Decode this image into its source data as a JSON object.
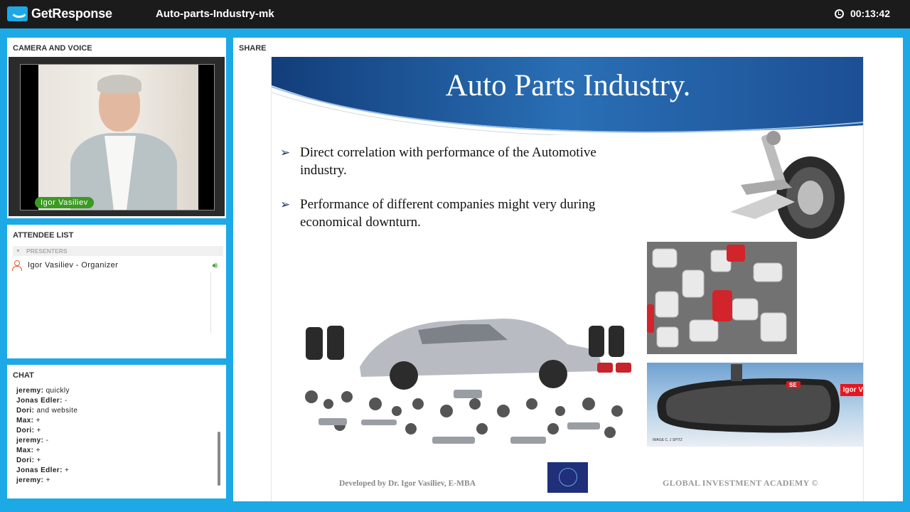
{
  "header": {
    "brand": "GetResponse",
    "webinar_title": "Auto-parts-Industry-mk",
    "timer": "00:13:42"
  },
  "camera": {
    "title": "CAMERA AND VOICE",
    "presenter_name": "Igor Vasiliev"
  },
  "attendees": {
    "title": "ATTENDEE LIST",
    "group_label": "PRESENTERS",
    "items": [
      {
        "name": "Igor Vasiliev - Organizer",
        "audio": "speaker-on-icon"
      }
    ]
  },
  "chat": {
    "title": "CHAT",
    "messages": [
      {
        "author": "jeremy:",
        "text": "quickly"
      },
      {
        "author": "Jonas Edler:",
        "text": "-"
      },
      {
        "author": "Dori:",
        "text": "and website"
      },
      {
        "author": "Max:",
        "text": "+"
      },
      {
        "author": "Dori:",
        "text": "+"
      },
      {
        "author": "jeremy:",
        "text": "-"
      },
      {
        "author": "Max:",
        "text": "+"
      },
      {
        "author": "Dori:",
        "text": "+"
      },
      {
        "author": "Jonas Edler:",
        "text": "+"
      },
      {
        "author": "jeremy:",
        "text": "+"
      }
    ]
  },
  "share": {
    "title": "SHARE",
    "slide": {
      "title": "Auto Parts Industry.",
      "bullets": [
        "Direct correlation with performance of the Automotive industry.",
        "Performance of different companies might very during economical downturn."
      ],
      "mirror_label": "Igor V",
      "mirror_display": "SE",
      "image_credit": "IMAGE C. J SPITZ",
      "footer_left": "Developed by Dr. Igor Vasiliev, E-MBA",
      "footer_right": "GLOBAL INVESTMENT ACADEMY ©"
    }
  },
  "colors": {
    "accent": "#1da8e6",
    "topbar": "#1b1b1b",
    "presenter_tag": "#3b9a22",
    "banner_blue": "#1f5aa0"
  }
}
